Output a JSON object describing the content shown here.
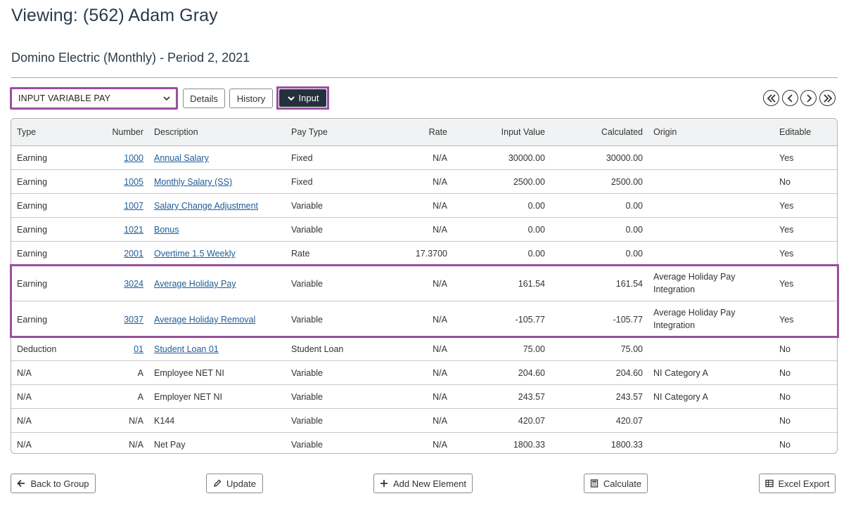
{
  "header": {
    "title": "Viewing: (562) Adam Gray",
    "subtitle": "Domino Electric (Monthly) - Period 2, 2021"
  },
  "toolbar": {
    "view_select_value": "INPUT VARIABLE PAY",
    "details_label": "Details",
    "history_label": "History",
    "input_label": "Input"
  },
  "table": {
    "headers": {
      "type": "Type",
      "number": "Number",
      "description": "Description",
      "pay_type": "Pay Type",
      "rate": "Rate",
      "input_value": "Input Value",
      "calculated": "Calculated",
      "origin": "Origin",
      "editable": "Editable"
    },
    "rows": [
      {
        "type": "Earning",
        "number": "1000",
        "description": "Annual Salary",
        "pay_type": "Fixed",
        "rate": "N/A",
        "input_value": "30000.00",
        "calculated": "30000.00",
        "origin": "",
        "editable": "Yes"
      },
      {
        "type": "Earning",
        "number": "1005",
        "description": "Monthly Salary (SS)",
        "pay_type": "Fixed",
        "rate": "N/A",
        "input_value": "2500.00",
        "calculated": "2500.00",
        "origin": "",
        "editable": "No"
      },
      {
        "type": "Earning",
        "number": "1007",
        "description": "Salary Change Adjustment",
        "pay_type": "Variable",
        "rate": "N/A",
        "input_value": "0.00",
        "calculated": "0.00",
        "origin": "",
        "editable": "Yes"
      },
      {
        "type": "Earning",
        "number": "1021",
        "description": "Bonus",
        "pay_type": "Variable",
        "rate": "N/A",
        "input_value": "0.00",
        "calculated": "0.00",
        "origin": "",
        "editable": "Yes"
      },
      {
        "type": "Earning",
        "number": "2001",
        "description": "Overtime 1.5 Weekly",
        "pay_type": "Rate",
        "rate": "17.3700",
        "input_value": "0.00",
        "calculated": "0.00",
        "origin": "",
        "editable": "Yes"
      },
      {
        "type": "Earning",
        "number": "3024",
        "description": "Average Holiday Pay",
        "pay_type": "Variable",
        "rate": "N/A",
        "input_value": "161.54",
        "calculated": "161.54",
        "origin": "Average Holiday Pay Integration",
        "editable": "Yes"
      },
      {
        "type": "Earning",
        "number": "3037",
        "description": "Average Holiday Removal",
        "pay_type": "Variable",
        "rate": "N/A",
        "input_value": "-105.77",
        "calculated": "-105.77",
        "origin": "Average Holiday Pay Integration",
        "editable": "Yes"
      },
      {
        "type": "Deduction",
        "number": "01",
        "description": "Student Loan 01",
        "pay_type": "Student Loan",
        "rate": "N/A",
        "input_value": "75.00",
        "calculated": "75.00",
        "origin": "",
        "editable": "No"
      },
      {
        "type": "N/A",
        "number": "A",
        "description": "Employee NET NI",
        "pay_type": "Variable",
        "rate": "N/A",
        "input_value": "204.60",
        "calculated": "204.60",
        "origin": "NI Category A",
        "editable": "No"
      },
      {
        "type": "N/A",
        "number": "A",
        "description": "Employer NET NI",
        "pay_type": "Variable",
        "rate": "N/A",
        "input_value": "243.57",
        "calculated": "243.57",
        "origin": "NI Category A",
        "editable": "No"
      },
      {
        "type": "N/A",
        "number": "N/A",
        "description": "K144",
        "pay_type": "Variable",
        "rate": "N/A",
        "input_value": "420.07",
        "calculated": "420.07",
        "origin": "",
        "editable": "No"
      },
      {
        "type": "N/A",
        "number": "N/A",
        "description": "Net Pay",
        "pay_type": "Variable",
        "rate": "N/A",
        "input_value": "1800.33",
        "calculated": "1800.33",
        "origin": "",
        "editable": "No"
      }
    ]
  },
  "footer": {
    "back_label": "Back to Group",
    "update_label": "Update",
    "add_label": "Add New Element",
    "calculate_label": "Calculate",
    "export_label": "Excel Export"
  },
  "colors": {
    "highlight": "#9b4f9f",
    "link": "#1f5c99",
    "dark_button": "#24313d"
  }
}
